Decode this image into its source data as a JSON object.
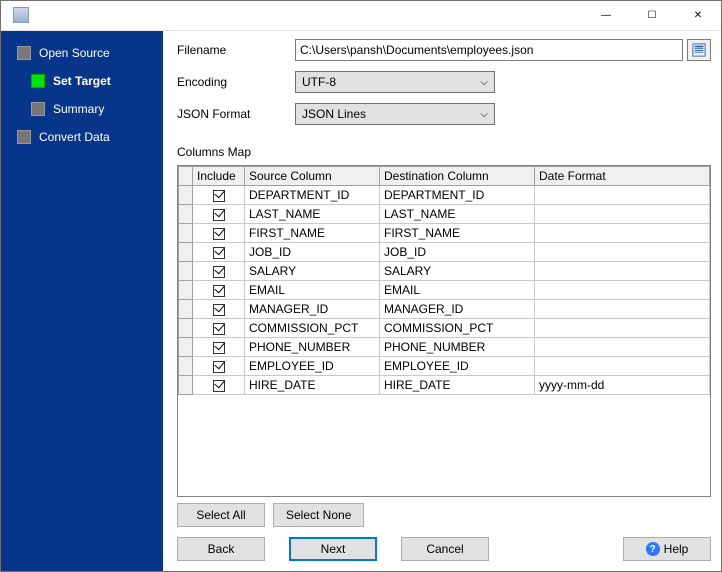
{
  "window": {
    "minimize_glyph": "—",
    "maximize_glyph": "☐",
    "close_glyph": "✕"
  },
  "sidebar": {
    "items": [
      {
        "label": "Open Source",
        "active": false,
        "indent": "open"
      },
      {
        "label": "Set Target",
        "active": true,
        "indent": "sub"
      },
      {
        "label": "Summary",
        "active": false,
        "indent": "sub"
      },
      {
        "label": "Convert Data",
        "active": false,
        "indent": "open"
      }
    ]
  },
  "form": {
    "filename_label": "Filename",
    "filename_value": "C:\\Users\\pansh\\Documents\\employees.json",
    "encoding_label": "Encoding",
    "encoding_value": "UTF-8",
    "json_format_label": "JSON Format",
    "json_format_value": "JSON Lines"
  },
  "columns": {
    "section_label": "Columns Map",
    "headers": {
      "include": "Include",
      "source": "Source Column",
      "destination": "Destination Column",
      "date_format": "Date Format"
    },
    "rows": [
      {
        "include": true,
        "source": "DEPARTMENT_ID",
        "destination": "DEPARTMENT_ID",
        "date_format": ""
      },
      {
        "include": true,
        "source": "LAST_NAME",
        "destination": "LAST_NAME",
        "date_format": ""
      },
      {
        "include": true,
        "source": "FIRST_NAME",
        "destination": "FIRST_NAME",
        "date_format": ""
      },
      {
        "include": true,
        "source": "JOB_ID",
        "destination": "JOB_ID",
        "date_format": ""
      },
      {
        "include": true,
        "source": "SALARY",
        "destination": "SALARY",
        "date_format": ""
      },
      {
        "include": true,
        "source": "EMAIL",
        "destination": "EMAIL",
        "date_format": ""
      },
      {
        "include": true,
        "source": "MANAGER_ID",
        "destination": "MANAGER_ID",
        "date_format": ""
      },
      {
        "include": true,
        "source": "COMMISSION_PCT",
        "destination": "COMMISSION_PCT",
        "date_format": ""
      },
      {
        "include": true,
        "source": "PHONE_NUMBER",
        "destination": "PHONE_NUMBER",
        "date_format": ""
      },
      {
        "include": true,
        "source": "EMPLOYEE_ID",
        "destination": "EMPLOYEE_ID",
        "date_format": ""
      },
      {
        "include": true,
        "source": "HIRE_DATE",
        "destination": "HIRE_DATE",
        "date_format": "yyyy-mm-dd"
      }
    ]
  },
  "buttons": {
    "select_all": "Select All",
    "select_none": "Select None",
    "back": "Back",
    "next": "Next",
    "cancel": "Cancel",
    "help": "Help"
  }
}
